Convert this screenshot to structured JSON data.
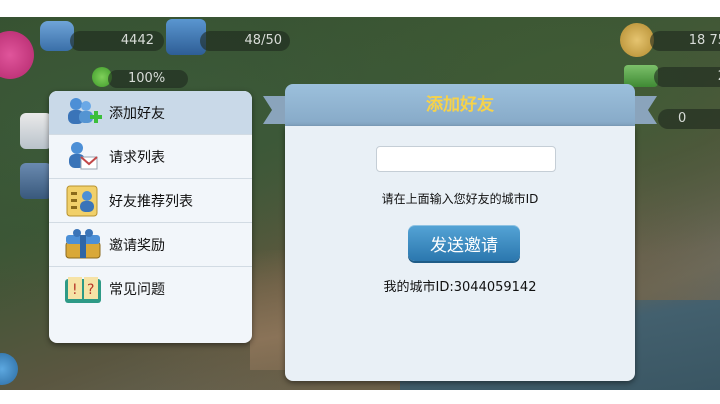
{
  "hud": {
    "population": "4442",
    "capacity": "48/50",
    "happiness": "100%",
    "money": "18 75",
    "right_value_1": "2",
    "right_value_2": "0"
  },
  "menu": {
    "items": [
      {
        "label": "添加好友",
        "icon": "add-friend-icon",
        "active": true
      },
      {
        "label": "请求列表",
        "icon": "request-list-icon",
        "active": false
      },
      {
        "label": "好友推荐列表",
        "icon": "recommend-list-icon",
        "active": false
      },
      {
        "label": "邀请奖励",
        "icon": "gift-chest-icon",
        "active": false
      },
      {
        "label": "常见问题",
        "icon": "faq-book-icon",
        "active": false
      }
    ]
  },
  "dialog": {
    "title": "添加好友",
    "input_value": "",
    "input_placeholder": "",
    "hint": "请在上面输入您好友的城市ID",
    "button_label": "发送邀请",
    "my_id_text": "我的城市ID:3044059142"
  },
  "colors": {
    "title_yellow": "#f6d24a",
    "button_blue": "#3a8cc6",
    "header_blue": "#93b6d3",
    "menu_active": "#c9d9e8"
  }
}
